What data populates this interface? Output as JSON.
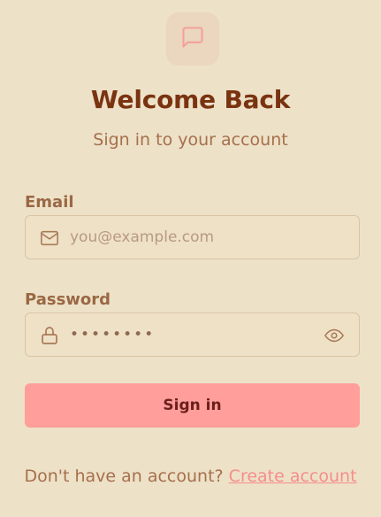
{
  "header": {
    "logo_icon": "chat-bubble-icon",
    "title": "Welcome Back",
    "subtitle": "Sign in to your account"
  },
  "form": {
    "email": {
      "label": "Email",
      "placeholder": "you@example.com",
      "value": "",
      "icon": "mail-icon"
    },
    "password": {
      "label": "Password",
      "value": "••••••••",
      "icon": "lock-icon",
      "toggle_icon": "eye-icon"
    },
    "submit_label": "Sign in"
  },
  "footer": {
    "prompt": "Don't have an account?",
    "link_label": "Create account"
  },
  "colors": {
    "background": "#EDE1C8",
    "title": "#7A3310",
    "accent_button": "#FF9E9B",
    "link": "#F58E8A"
  }
}
